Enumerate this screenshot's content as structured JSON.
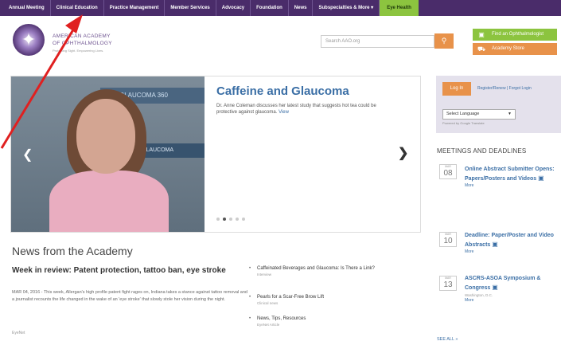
{
  "nav": {
    "items": [
      "Annual Meeting",
      "Clinical Education",
      "Practice Management",
      "Member Services",
      "Advocacy",
      "Foundation",
      "News",
      "Subspecialties & More ▾",
      "Eye Health"
    ]
  },
  "header": {
    "org_line1": "AMERICAN ACADEMY",
    "org_line2": "OF OPHTHALMOLOGY",
    "tagline": "Protecting Sight. Empowering Lives.",
    "search_placeholder": "Search AAO.org",
    "search_icon": "search-icon",
    "find_label": "Find an Ophthalmologist",
    "store_label": "Academy Store"
  },
  "hero": {
    "banner": "GLAUCOMA 360",
    "banner2": "GLAUCOMA",
    "title": "Caffeine and Glaucoma",
    "desc": "Dr. Anne Coleman discusses her latest study that suggests hot tea could be protective against glaucoma.",
    "more": "View",
    "slides": 5,
    "active_slide": 2
  },
  "news": {
    "heading": "News from the Academy",
    "week_title": "Week in review: Patent protection, tattoo ban, eye stroke",
    "week_body": "MAR 04, 2016 - This week, Allergan's high profile patent fight rages on, Indiana takes a stance against tattoo removal and a journalist recounts the life changed in the wake of an 'eye stroke' that slowly stole her vision during the night.",
    "week_source": "EyeNet",
    "links": [
      {
        "title": "Caffeinated Beverages and Glaucoma: Is There a Link?",
        "sub": "Interview"
      },
      {
        "title": "Pearls for a Scar-Free Brow Lift",
        "sub": "Clinical news"
      },
      {
        "title": "News, Tips, Resources",
        "sub": "EyeNet Article"
      }
    ]
  },
  "sidebar": {
    "login": "Log In",
    "register": "Register/Renew | Forgot Login",
    "language": "Select Language",
    "powered": "Powered by Google Translate",
    "meetings_heading": "MEETINGS AND DEADLINES",
    "events": [
      {
        "mon": "MAR",
        "day": "08",
        "title": "Online Abstract Submitter Opens: Papers/Posters and Videos",
        "loc": "",
        "more": "More"
      },
      {
        "mon": "MAR",
        "day": "10",
        "title": "Deadline: Paper/Poster and Video Abstracts",
        "loc": "",
        "more": "More"
      },
      {
        "mon": "MAR",
        "day": "13",
        "title": "ASCRS-ASOA Symposium & Congress",
        "loc": "Washington, D.C.",
        "more": "More"
      }
    ],
    "see_all": "SEE ALL »"
  },
  "colors": {
    "nav_bg": "#4a2c6a",
    "accent_green": "#8cc43f",
    "accent_orange": "#e8924a",
    "link_blue": "#3a6ea5",
    "annotation_red": "#e02020"
  }
}
